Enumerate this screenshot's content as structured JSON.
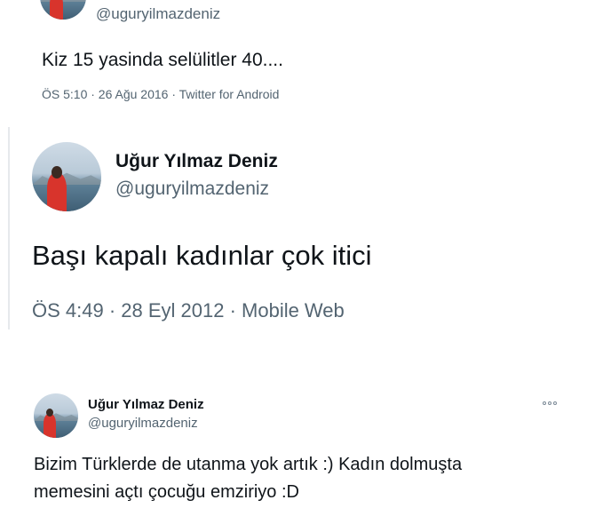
{
  "tweet1": {
    "handle": "@uguryilmazdeniz",
    "text": "Kiz 15 yasinda selülitler 40....",
    "meta": "ÖS 5:10 · 26 Ağu 2016 · Twitter for Android"
  },
  "tweet2": {
    "name": "Uğur Yılmaz Deniz",
    "handle": "@uguryilmazdeniz",
    "text": "Başı kapalı kadınlar çok itici",
    "meta": "ÖS 4:49 · 28 Eyl 2012 · Mobile Web"
  },
  "tweet3": {
    "name": "Uğur Yılmaz Deniz",
    "handle": "@uguryilmazdeniz",
    "text_line1": "Bizim Türklerde de utanma yok artık :) Kadın dolmuşta",
    "text_line2": "memesini açtı çocuğu emziriyo :D"
  },
  "icons": {
    "more": "more-options-icon",
    "avatar": "profile-avatar"
  },
  "colors": {
    "text": "#0f1419",
    "secondary": "#536471"
  }
}
